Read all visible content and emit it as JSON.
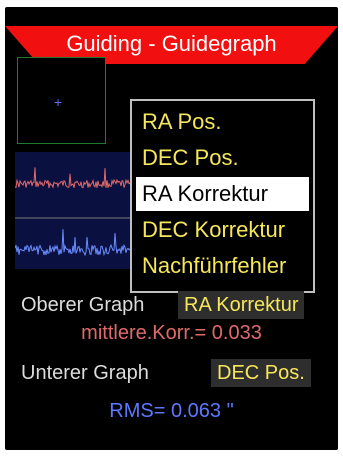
{
  "title": "Guiding - Guidegraph",
  "colors": {
    "title_bar": "#f20f0f",
    "accent_yellow": "#f5e65a",
    "ra_trace": "#e06a6a",
    "dec_trace": "#6b8cff"
  },
  "menu": {
    "items": [
      {
        "label": "RA  Pos."
      },
      {
        "label": "DEC Pos."
      },
      {
        "label": "RA Korrektur",
        "selected": true
      },
      {
        "label": "DEC Korrektur"
      },
      {
        "label": "Nachführfehler"
      }
    ]
  },
  "upper": {
    "label": "Oberer Graph",
    "value": "RA Korrektur",
    "stat": "mittlere.Korr.= 0.033"
  },
  "lower": {
    "label": "Unterer Graph",
    "value": "DEC Pos.",
    "stat": "RMS= 0.063 \""
  },
  "icons": {
    "crosshair": "plus-icon"
  }
}
